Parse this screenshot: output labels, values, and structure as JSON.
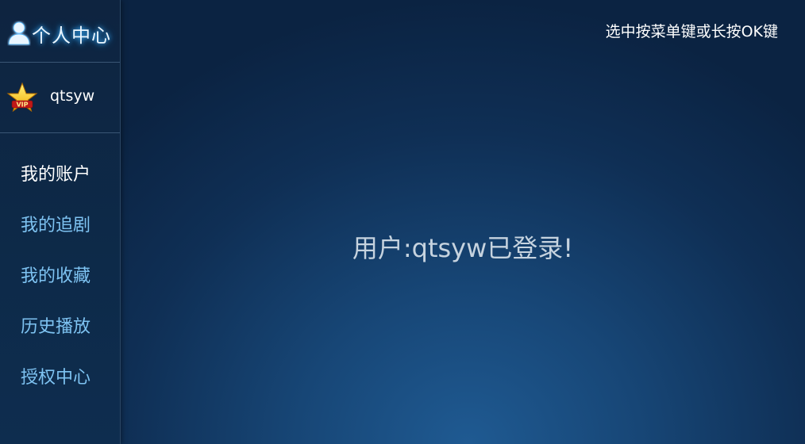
{
  "sidebar": {
    "header": {
      "title": "个人中心",
      "icon": "user-icon"
    },
    "user": {
      "name": "qtsyw",
      "badge_icon": "vip-star-icon",
      "badge_text": "VIP"
    },
    "menu": [
      {
        "label": "我的账户",
        "active": true
      },
      {
        "label": "我的追剧",
        "active": false
      },
      {
        "label": "我的收藏",
        "active": false
      },
      {
        "label": "历史播放",
        "active": false
      },
      {
        "label": "授权中心",
        "active": false
      }
    ]
  },
  "main": {
    "hint": "选中按菜单键或长按OK键",
    "status": "用户:qtsyw已登录!"
  },
  "colors": {
    "accent": "#7ec3f2",
    "active": "#ffffff",
    "glow": "#3fb4ff"
  }
}
